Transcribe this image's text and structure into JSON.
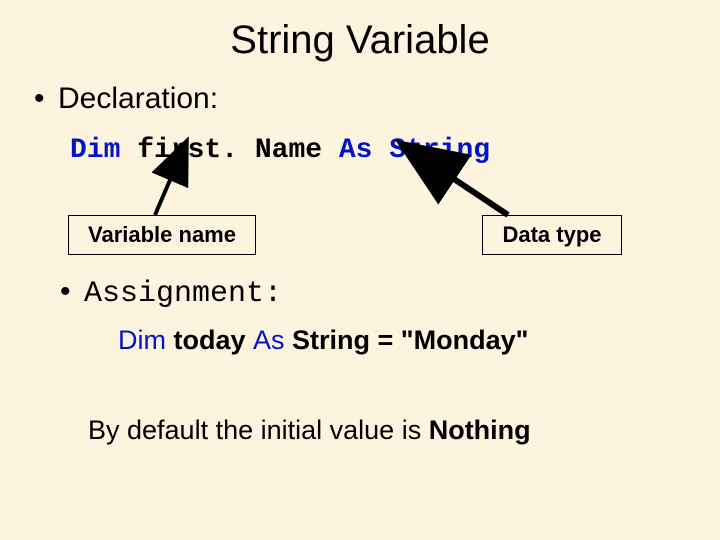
{
  "title": "String Variable",
  "bullet_declaration": "Declaration:",
  "code": {
    "dim": "Dim ",
    "ident": "first. Name ",
    "as": "As ",
    "type": "String"
  },
  "box_varname": "Variable name",
  "box_datatype": "Data type",
  "bullet_assignment": "Assignment:",
  "assign": {
    "dim": "Dim",
    "today": " today ",
    "as": "As",
    "string": " String ",
    "rest": "= \"Monday\""
  },
  "footer": {
    "pre": "By default the initial value is ",
    "nothing": "Nothing"
  }
}
